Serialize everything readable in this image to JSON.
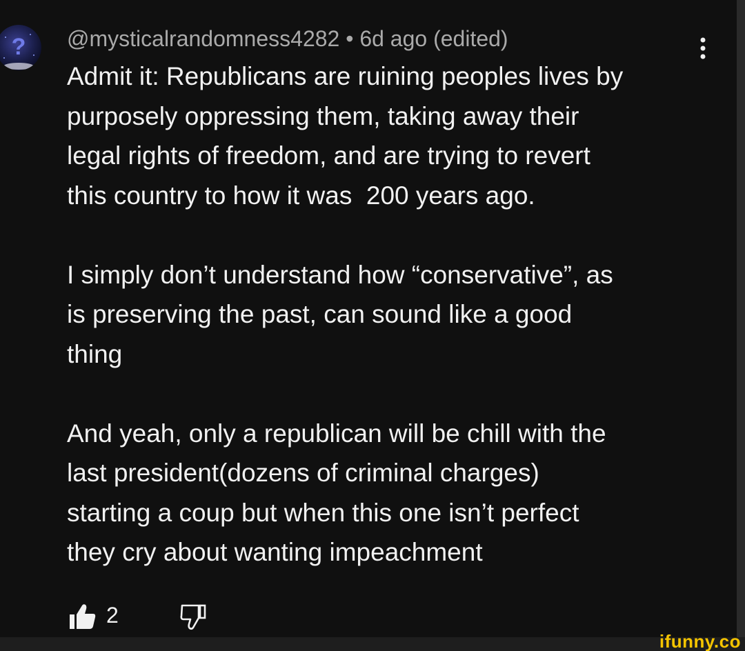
{
  "comment": {
    "author": "@mysticalrandomness4282",
    "separator": "•",
    "timestamp": "6d ago (edited)",
    "paragraphs": [
      [
        "Admit it: Republicans are ruining peoples lives by",
        "purposely oppressing them, taking away their",
        "legal rights of freedom, and are trying to revert",
        "this country to how it was  200 years ago."
      ],
      [
        "I simply don’t understand how “conservative”, as",
        "is preserving the past, can sound like a good",
        "thing"
      ],
      [
        "And yeah, only a republican will be chill with the",
        "last president(dozens of criminal charges)",
        "starting a coup but when this one isn’t perfect",
        "they cry about wanting impeachment"
      ]
    ],
    "like_count": "2"
  },
  "icons": {
    "avatar": "question-mark-avatar",
    "more": "vertical-ellipsis-icon",
    "like": "thumbs-up-filled-icon",
    "dislike": "thumbs-down-outline-icon"
  },
  "watermark": "ifunny.co",
  "colors": {
    "background": "#101010",
    "text_primary": "#f1f1f1",
    "text_secondary": "#aaaaaa",
    "watermark": "#f5c400"
  }
}
